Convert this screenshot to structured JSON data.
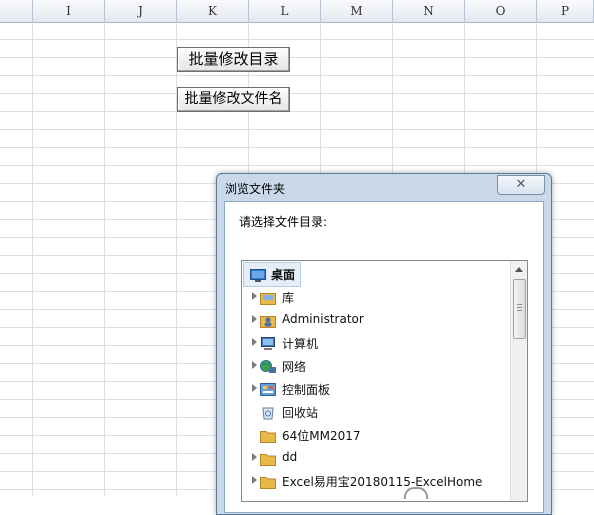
{
  "columns": [
    "I",
    "J",
    "K",
    "L",
    "M",
    "N",
    "O",
    "P"
  ],
  "buttons": {
    "modify_dir": "批量修改目录",
    "modify_filename": "批量修改文件名"
  },
  "dialog": {
    "title": "浏览文件夹",
    "close_glyph": "✕",
    "prompt": "请选择文件目录:",
    "tree": [
      {
        "label": "桌面",
        "icon": "desktop-icon",
        "expandable": false,
        "selected": true
      },
      {
        "label": "库",
        "icon": "library-icon",
        "expandable": true,
        "selected": false
      },
      {
        "label": "Administrator",
        "icon": "user-folder-icon",
        "expandable": true,
        "selected": false
      },
      {
        "label": "计算机",
        "icon": "computer-icon",
        "expandable": true,
        "selected": false
      },
      {
        "label": "网络",
        "icon": "network-icon",
        "expandable": true,
        "selected": false
      },
      {
        "label": "控制面板",
        "icon": "control-panel-icon",
        "expandable": true,
        "selected": false
      },
      {
        "label": "回收站",
        "icon": "recycle-bin-icon",
        "expandable": false,
        "selected": false
      },
      {
        "label": "64位MM2017",
        "icon": "folder-icon",
        "expandable": false,
        "selected": false
      },
      {
        "label": "dd",
        "icon": "folder-icon",
        "expandable": true,
        "selected": false
      },
      {
        "label": "Excel易用宝20180115-ExcelHome",
        "icon": "folder-icon",
        "expandable": true,
        "selected": false
      }
    ]
  },
  "colors": {
    "folder": "#e8b84a",
    "dialog_frame": "#c9d9ea",
    "selection": "#e5eef8"
  }
}
